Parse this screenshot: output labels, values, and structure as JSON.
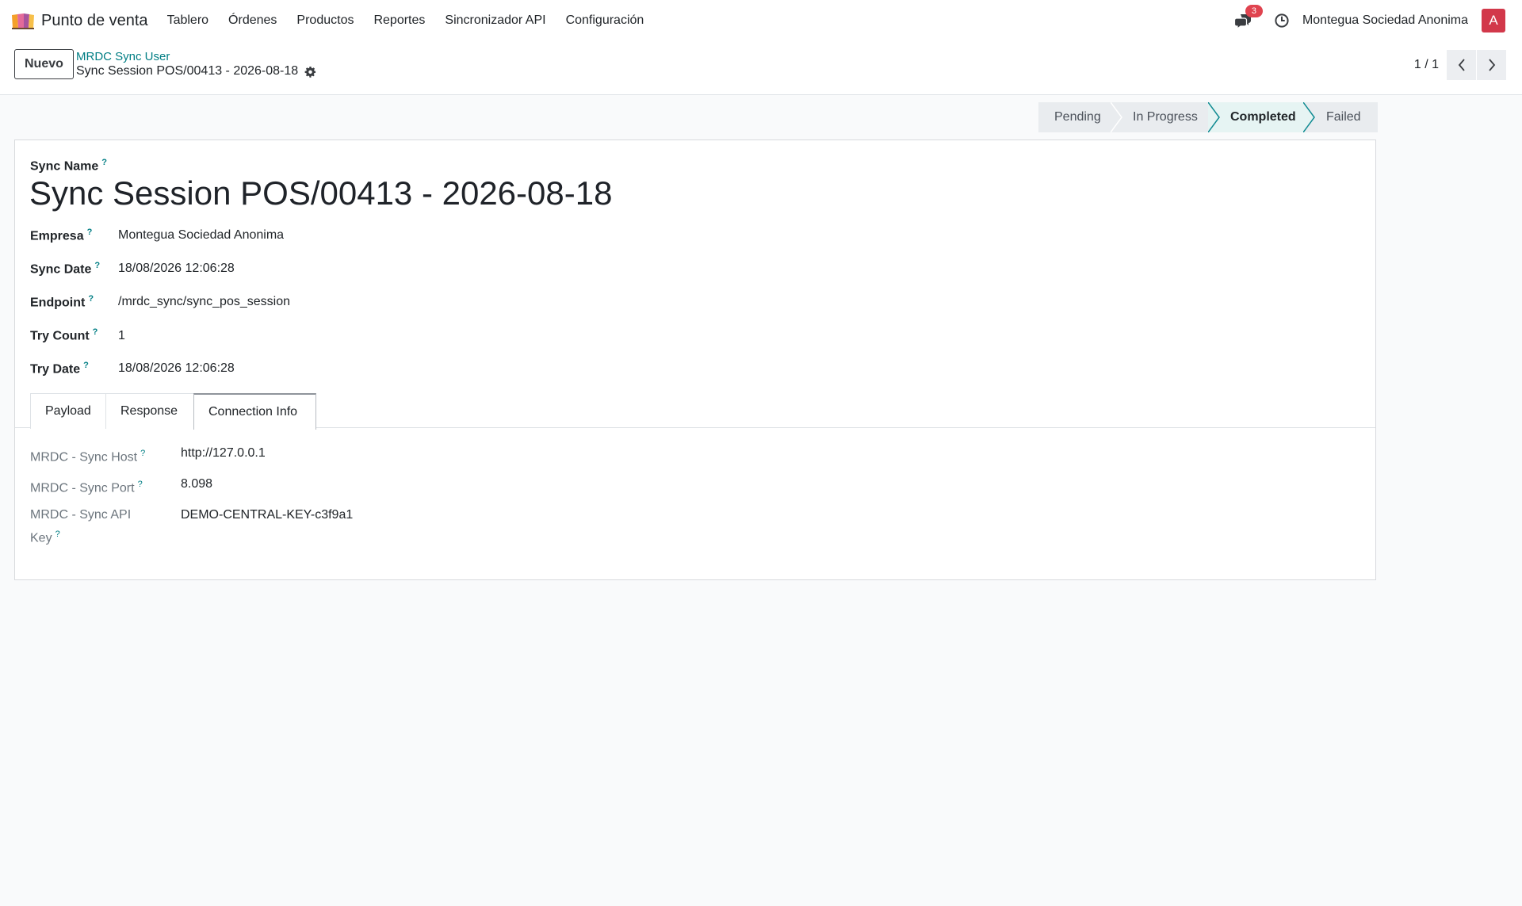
{
  "navbar": {
    "app_name": "Punto de venta",
    "menu": [
      {
        "label": "Tablero"
      },
      {
        "label": "Órdenes"
      },
      {
        "label": "Productos"
      },
      {
        "label": "Reportes"
      },
      {
        "label": "Sincronizador API"
      },
      {
        "label": "Configuración"
      }
    ],
    "messages_count": "3",
    "company": "Montegua Sociedad Anonima",
    "user_initial": "A",
    "icons": [
      "app-logo-icon",
      "chat-icon",
      "clock-icon"
    ],
    "colors": {
      "avatar": "#d2384a",
      "badge": "#e0434f",
      "accent": "#017e84"
    }
  },
  "control_panel": {
    "new_button": "Nuevo",
    "breadcrumb_parent": "MRDC Sync User",
    "breadcrumb_current": "Sync Session POS/00413 - 2026-08-18",
    "pager": "1 / 1",
    "icons": [
      "gear-icon",
      "chevron-left-icon",
      "chevron-right-icon"
    ]
  },
  "statusbar": {
    "stages": [
      {
        "label": "Pending"
      },
      {
        "label": "In Progress"
      },
      {
        "label": "Completed"
      },
      {
        "label": "Failed"
      }
    ],
    "active": "Completed"
  },
  "form": {
    "help_mark": "?",
    "name_label": "Sync Name",
    "name_value": "Sync Session POS/00413 - 2026-08-18",
    "fields": [
      {
        "label": "Empresa",
        "value": "Montegua Sociedad Anonima"
      },
      {
        "label": "Sync Date",
        "value": "18/08/2026 12:06:28"
      },
      {
        "label": "Endpoint",
        "value": "/mrdc_sync/sync_pos_session"
      },
      {
        "label": "Try Count",
        "value": "1"
      },
      {
        "label": "Try Date",
        "value": "18/08/2026 12:06:28"
      }
    ],
    "tabs": [
      {
        "label": "Payload"
      },
      {
        "label": "Response"
      },
      {
        "label": "Connection Info"
      }
    ],
    "active_tab": "Connection Info",
    "connection": [
      {
        "label": "MRDC - Sync Host",
        "value": "http://127.0.0.1"
      },
      {
        "label": "MRDC - Sync Port",
        "value": "8.098"
      },
      {
        "label_line1": "MRDC - Sync API",
        "label_line2": "Key",
        "value": "DEMO-CENTRAL-KEY-c3f9a1"
      }
    ]
  }
}
